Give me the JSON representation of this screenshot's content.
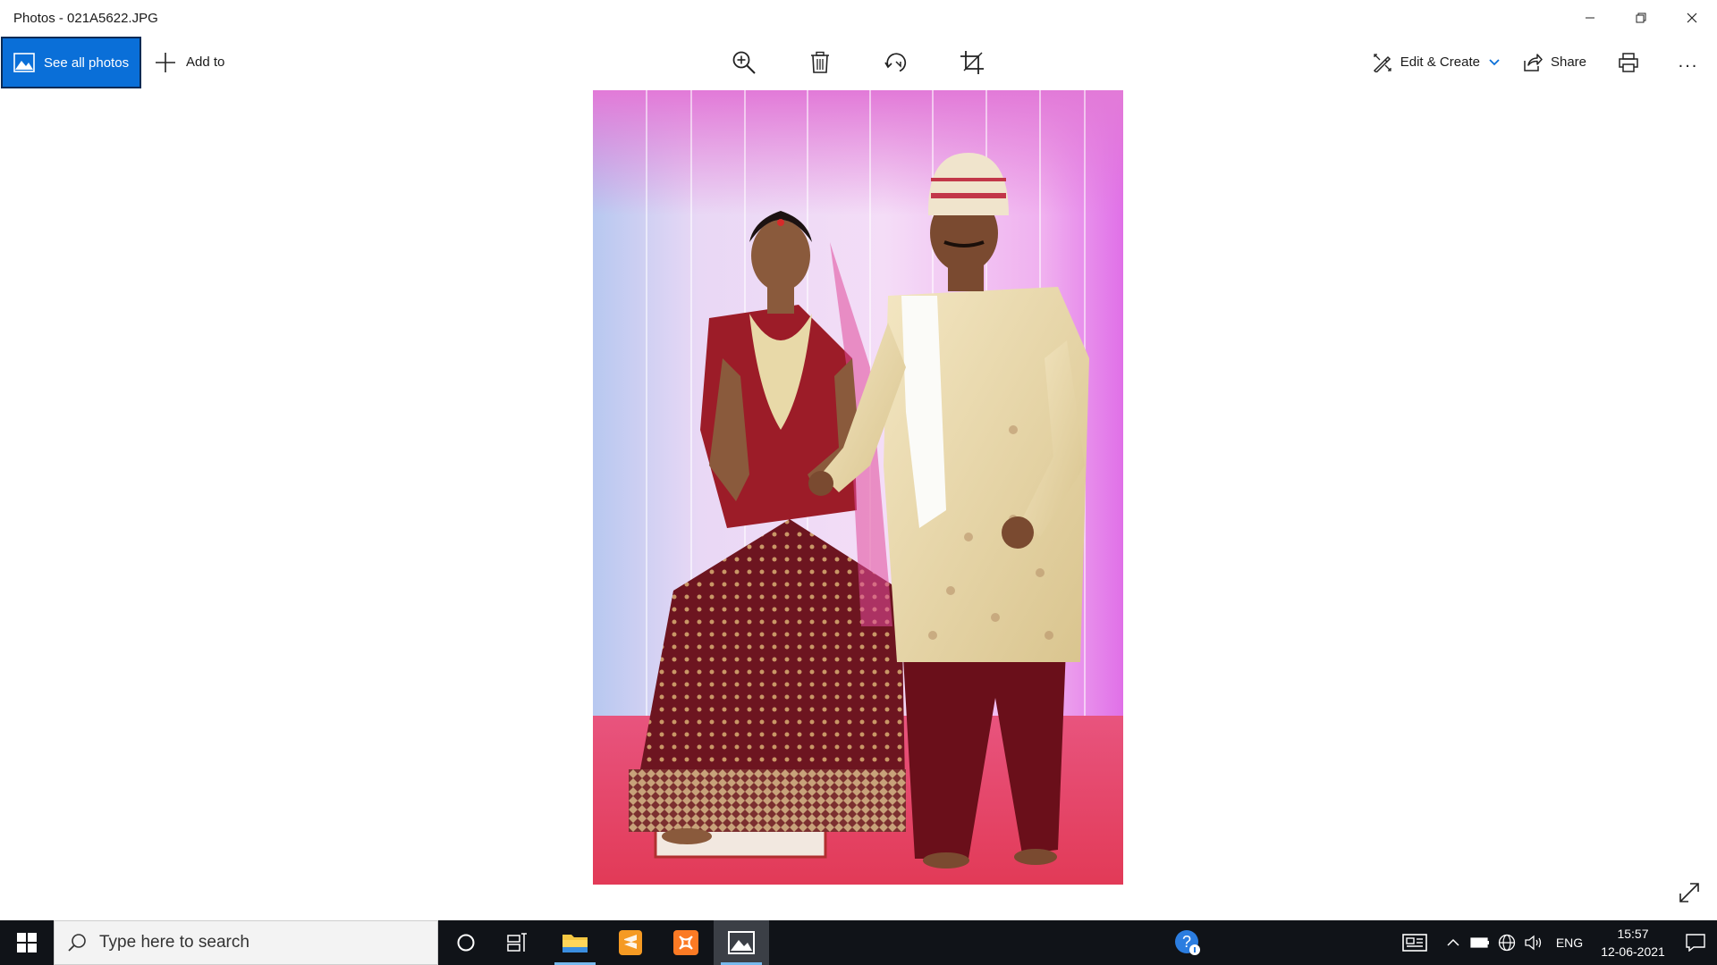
{
  "window": {
    "title": "Photos - 021A5622.JPG",
    "controls": [
      "minimize",
      "restore",
      "close"
    ]
  },
  "toolbar": {
    "see_all_label": "See all photos",
    "add_to_label": "Add to",
    "center_tools": [
      "zoom-in-icon",
      "delete-icon",
      "rotate-icon",
      "crop-icon"
    ],
    "edit_create_label": "Edit & Create",
    "share_label": "Share",
    "more_label": "..."
  },
  "photo": {
    "subject": "bride-and-groom"
  },
  "taskbar": {
    "search_placeholder": "Type here to search",
    "pinned": [
      "cortana-icon",
      "task-view-icon",
      "file-explorer-icon",
      "sublime-text-icon",
      "xampp-icon",
      "photos-icon"
    ],
    "active_app": "photos-icon",
    "tray": {
      "language": "ENG",
      "time": "15:57",
      "date": "12-06-2021"
    }
  },
  "colors": {
    "accent": "#0a6fd8",
    "taskbar_bg": "#101318",
    "active_indicator": "#76b9ed"
  }
}
